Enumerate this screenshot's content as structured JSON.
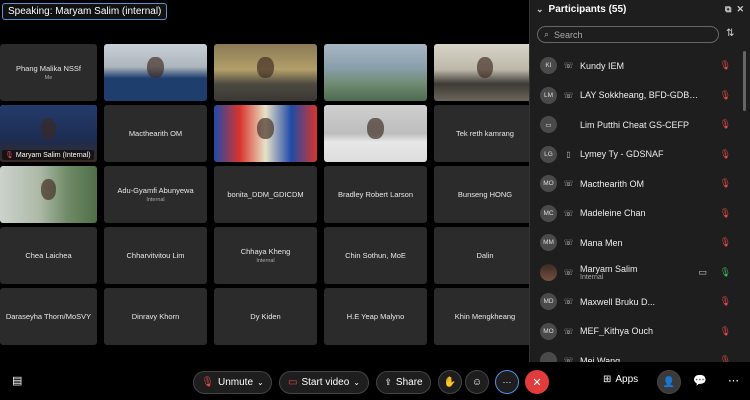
{
  "speaking": "Speaking: Maryam Salim (internal)",
  "tiles": [
    {
      "name": "Phang Malika NSSf",
      "sub": "Me",
      "type": "name"
    },
    {
      "name": "",
      "type": "video",
      "scene": "man-blue"
    },
    {
      "name": "",
      "type": "video",
      "scene": "man-glasses"
    },
    {
      "name": "",
      "type": "video",
      "scene": "landscape"
    },
    {
      "name": "",
      "type": "video",
      "scene": "meeting"
    },
    {
      "name": "Maryam Salim (Internal)",
      "type": "video",
      "scene": "maryam",
      "active": true
    },
    {
      "name": "Macthearith OM",
      "type": "name"
    },
    {
      "name": "",
      "type": "video",
      "scene": "flags"
    },
    {
      "name": "",
      "type": "video",
      "scene": "man-office"
    },
    {
      "name": "Tek reth kamrang",
      "type": "name"
    },
    {
      "name": "",
      "type": "video",
      "scene": "woman-window"
    },
    {
      "name": "Adu-Gyamfi Abunyewa",
      "sub": "Internal",
      "type": "name"
    },
    {
      "name": "bonita_DDM_GDICDM",
      "type": "name"
    },
    {
      "name": "Bradley Robert Larson",
      "type": "name"
    },
    {
      "name": "Bunseng HONG",
      "type": "name"
    },
    {
      "name": "Chea Laichea",
      "type": "name"
    },
    {
      "name": "Chharvitvitou Lim",
      "type": "name"
    },
    {
      "name": "Chhaya Kheng",
      "sub": "Internal",
      "type": "name"
    },
    {
      "name": "Chin Sothun, MoE",
      "type": "name"
    },
    {
      "name": "Dalin",
      "type": "name"
    },
    {
      "name": "Daraseyha Thorn/MoSVY",
      "type": "name"
    },
    {
      "name": "Dinravy Khorn",
      "type": "name"
    },
    {
      "name": "Dy Kiden",
      "type": "name"
    },
    {
      "name": "H.E Yeap Malyno",
      "type": "name"
    },
    {
      "name": "Khin Mengkheang",
      "type": "name"
    }
  ],
  "panel": {
    "title": "Participants (55)",
    "search_placeholder": "Search",
    "participants": [
      {
        "initials": "KI",
        "name": "Kundy IEM",
        "device": "phone-call"
      },
      {
        "initials": "LM",
        "name": "LAY Sokkheang, BFD-GDB, ...",
        "device": "phone-call"
      },
      {
        "initials": "",
        "name": "Lim Putthi Cheat GS-CEFP",
        "device": "none",
        "icon": "device"
      },
      {
        "initials": "LG",
        "name": "Lymey Ty - GDSNAF",
        "device": "mobile"
      },
      {
        "initials": "MO",
        "name": "Macthearith OM",
        "device": "phone-call"
      },
      {
        "initials": "MC",
        "name": "Madeleine Chan",
        "device": "phone-call"
      },
      {
        "initials": "MM",
        "name": "Mana Men",
        "device": "phone-call"
      },
      {
        "initials": "",
        "name": "Maryam Salim",
        "tag": "Internal",
        "device": "phone-call",
        "photo": true,
        "camera": true,
        "speaking": true
      },
      {
        "initials": "MD",
        "name": "Maxwell Bruku D...",
        "device": "phone-call"
      },
      {
        "initials": "MO",
        "name": "MEF_Kithya Ouch",
        "device": "phone-call"
      },
      {
        "initials": "",
        "name": "Mei Wang",
        "device": "phone-call"
      }
    ]
  },
  "toolbar": {
    "unmute": "Unmute",
    "start_video": "Start video",
    "share": "Share",
    "more": "···",
    "apps": "Apps"
  }
}
